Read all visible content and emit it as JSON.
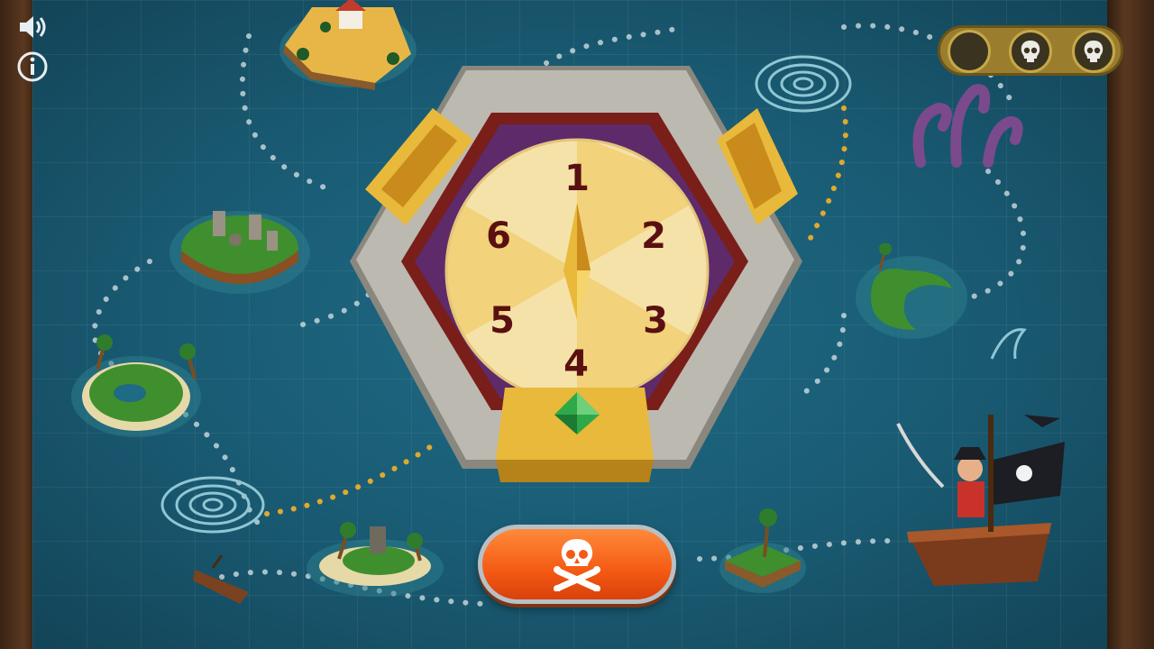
{
  "controls": {
    "sound_icon": "speaker-icon",
    "info_icon": "info-icon"
  },
  "lives": {
    "slots": [
      "empty",
      "skull",
      "skull"
    ]
  },
  "dial": {
    "numbers": [
      "1",
      "2",
      "3",
      "4",
      "5",
      "6"
    ],
    "pointer": "1",
    "gem_color": "#2fa84a"
  },
  "play_button": {
    "icon": "skull-crossbones-icon",
    "color": "#f45a14"
  },
  "colors": {
    "sea": "#1c5369",
    "dial_face": "#f5e2a8",
    "stone": "#b9b6ac",
    "gold": "#e8b93a"
  }
}
